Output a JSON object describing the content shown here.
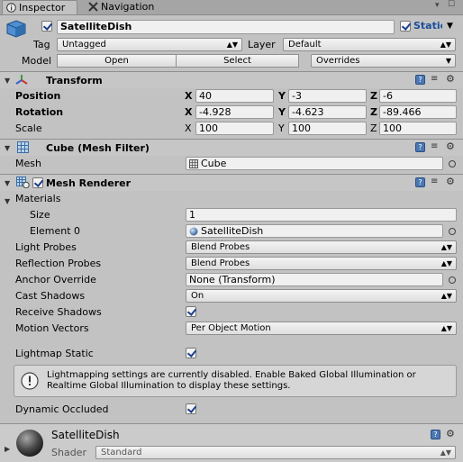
{
  "tabs": {
    "inspector": "Inspector",
    "navigation": "Navigation"
  },
  "object": {
    "name": "SatelliteDish",
    "static_label": "Static",
    "tag_label": "Tag",
    "tag_value": "Untagged",
    "layer_label": "Layer",
    "layer_value": "Default",
    "model_label": "Model",
    "open_button": "Open",
    "select_button": "Select",
    "overrides_button": "Overrides"
  },
  "transform": {
    "title": "Transform",
    "position_label": "Position",
    "rotation_label": "Rotation",
    "scale_label": "Scale",
    "axis_x": "X",
    "axis_y": "Y",
    "axis_z": "Z",
    "position": {
      "x": "40",
      "y": "-3",
      "z": "-6"
    },
    "rotation": {
      "x": "-4.928",
      "y": "-4.623",
      "z": "-89.466"
    },
    "scale": {
      "x": "100",
      "y": "100",
      "z": "100"
    }
  },
  "mesh_filter": {
    "title": "Cube (Mesh Filter)",
    "mesh_label": "Mesh",
    "mesh_value": "Cube"
  },
  "mesh_renderer": {
    "title": "Mesh Renderer",
    "materials_label": "Materials",
    "size_label": "Size",
    "size_value": "1",
    "element0_label": "Element 0",
    "element0_value": "SatelliteDish",
    "light_probes_label": "Light Probes",
    "light_probes_value": "Blend Probes",
    "reflection_probes_label": "Reflection Probes",
    "reflection_probes_value": "Blend Probes",
    "anchor_override_label": "Anchor Override",
    "anchor_override_value": "None (Transform)",
    "cast_shadows_label": "Cast Shadows",
    "cast_shadows_value": "On",
    "receive_shadows_label": "Receive Shadows",
    "receive_shadows_checked": true,
    "motion_vectors_label": "Motion Vectors",
    "motion_vectors_value": "Per Object Motion",
    "lightmap_static_label": "Lightmap Static",
    "lightmap_static_checked": true,
    "info_text_line1": "Lightmapping settings are currently disabled. Enable Baked Global Illumination or",
    "info_text_line2": "Realtime Global Illumination to display these settings.",
    "dynamic_occluded_label": "Dynamic Occluded",
    "dynamic_occluded_checked": true
  },
  "material": {
    "name": "SatelliteDish",
    "shader_label": "Shader",
    "shader_value": "Standard"
  },
  "colors": {
    "panel_bg": "#c2c2c2",
    "accent_blue": "#1a4f9c",
    "header_bg": "#c6c6c6"
  },
  "icons": {
    "inspector_tab": "info-icon",
    "navigation_tab": "navigation-icon",
    "gameobject": "cube-icon",
    "transform": "transform-axes-icon",
    "mesh_filter": "grid-icon",
    "mesh_renderer": "mesh-renderer-icon",
    "help": "help-icon",
    "presets": "sliders-icon",
    "settings": "gear-icon",
    "info": "info-circle-icon"
  }
}
